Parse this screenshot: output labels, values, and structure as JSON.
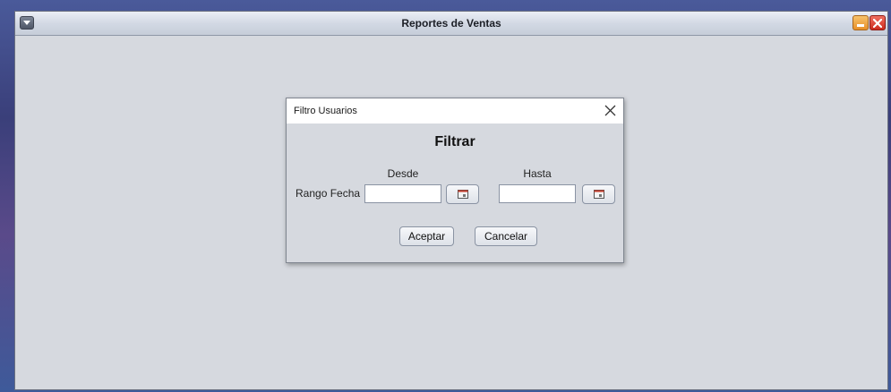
{
  "window": {
    "title": "Reportes de Ventas",
    "icons": {
      "menu": "menu-icon",
      "minimize": "minimize-icon",
      "close": "close-icon"
    }
  },
  "dialog": {
    "title": "Filtro Usuarios",
    "heading": "Filtrar",
    "columns": {
      "from_label": "Desde",
      "to_label": "Hasta"
    },
    "row_label": "Rango Fecha",
    "from_value": "",
    "to_value": "",
    "accept_label": "Aceptar",
    "cancel_label": "Cancelar",
    "icons": {
      "close": "close-icon",
      "calendar": "calendar-icon"
    }
  },
  "colors": {
    "window_background": "#d6d9df",
    "dialog_titlebar": "#ffffff",
    "close_button": "#cc2a1e",
    "minimize_button": "#e8902a"
  }
}
